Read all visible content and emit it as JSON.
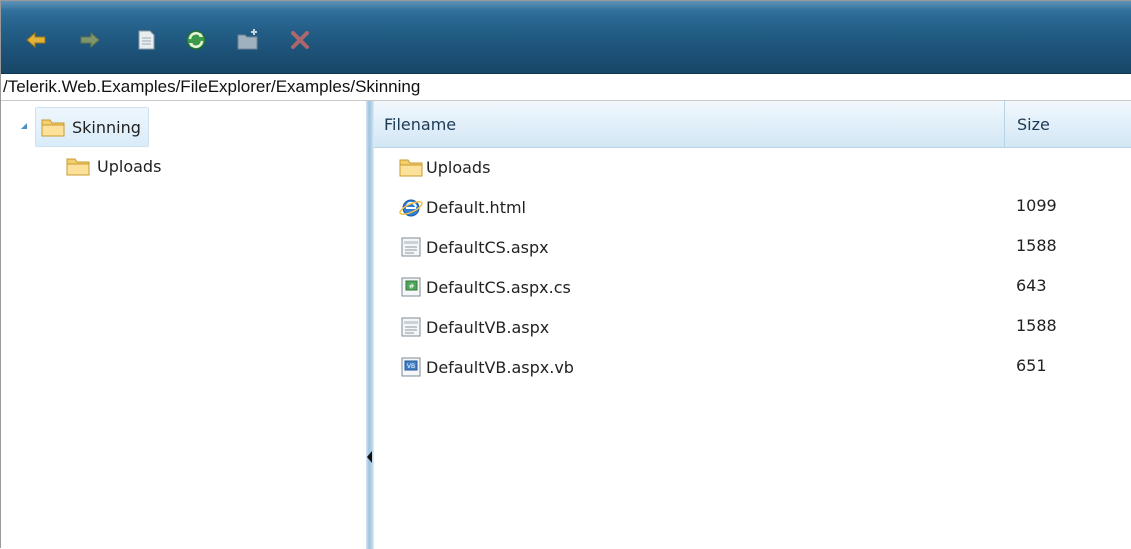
{
  "toolbar": {
    "buttons": [
      {
        "name": "back",
        "icon": "back-arrow-icon"
      },
      {
        "name": "forward",
        "icon": "forward-arrow-icon"
      },
      {
        "name": "open",
        "icon": "document-icon"
      },
      {
        "name": "refresh",
        "icon": "refresh-icon"
      },
      {
        "name": "new-folder",
        "icon": "new-folder-icon"
      },
      {
        "name": "delete",
        "icon": "delete-x-icon"
      }
    ],
    "colors": {
      "bar": "#235e87",
      "disabled_icon": "#8aa3b6",
      "arrow": "#e2b33a"
    }
  },
  "address": {
    "path": "/Telerik.Web.Examples/FileExplorer/Examples/Skinning"
  },
  "tree": {
    "root": {
      "label": "Skinning",
      "expanded": true,
      "selected": true,
      "icon": "folder-icon"
    },
    "children": [
      {
        "label": "Uploads",
        "icon": "folder-icon"
      }
    ]
  },
  "grid": {
    "columns": {
      "name": "Filename",
      "size": "Size"
    },
    "rows": [
      {
        "name": "Uploads",
        "size": "",
        "icon": "folder-icon"
      },
      {
        "name": "Default.html",
        "size": "1099",
        "icon": "ie-html-icon"
      },
      {
        "name": "DefaultCS.aspx",
        "size": "1588",
        "icon": "aspx-page-icon"
      },
      {
        "name": "DefaultCS.aspx.cs",
        "size": "643",
        "icon": "csharp-file-icon"
      },
      {
        "name": "DefaultVB.aspx",
        "size": "1588",
        "icon": "aspx-page-icon"
      },
      {
        "name": "DefaultVB.aspx.vb",
        "size": "651",
        "icon": "vb-file-icon"
      }
    ]
  }
}
